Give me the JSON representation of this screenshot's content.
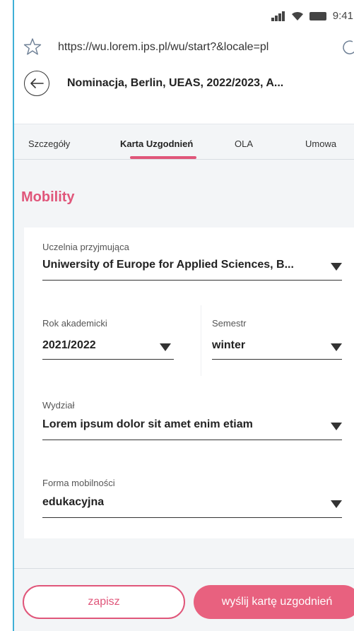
{
  "status_bar": {
    "time": "9:41",
    "icons": [
      "signal-icon",
      "wifi-icon",
      "battery-icon"
    ]
  },
  "browser": {
    "url": "https://wu.lorem.ips.pl/wu/start?&locale=pl"
  },
  "header": {
    "title": "Nominacja, Berlin, UEAS, 2022/2023, A..."
  },
  "tabs": [
    {
      "label": "Szczegóły",
      "active": false
    },
    {
      "label": "Karta Uzgodnień",
      "active": true
    },
    {
      "label": "OLA",
      "active": false
    },
    {
      "label": "Umowa",
      "active": false
    }
  ],
  "section": {
    "title": "Mobility"
  },
  "form": {
    "receiving_university": {
      "label": "Uczelnia przyjmująca",
      "value": "Uniwersity of Europe for Applied Sciences, B..."
    },
    "academic_year": {
      "label": "Rok akademicki",
      "value": "2021/2022"
    },
    "semester": {
      "label": "Semestr",
      "value": "winter"
    },
    "faculty": {
      "label": "Wydział",
      "value": "Lorem ipsum dolor sit amet enim etiam"
    },
    "mobility_form": {
      "label": "Forma mobilności",
      "value": "edukacyjna"
    }
  },
  "actions": {
    "save_label": "zapisz",
    "send_label": "wyślij kartę uzgodnień"
  },
  "colors": {
    "accent": "#e0567a",
    "accent_fill": "#e8617f",
    "frame": "#3fb0d6"
  }
}
